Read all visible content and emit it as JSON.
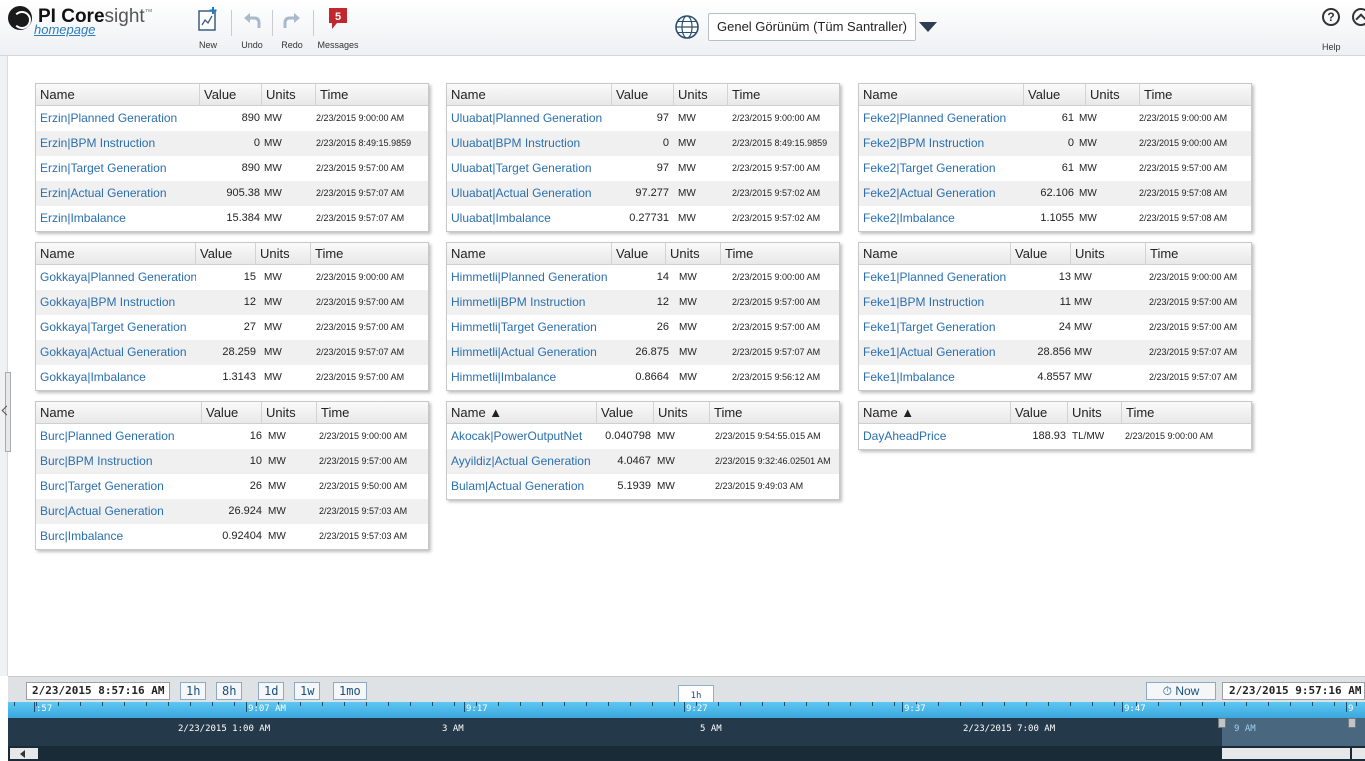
{
  "header": {
    "logo_bold": "PI Core",
    "logo_light": "sight",
    "logo_tm": "™",
    "homepage_link": "homepage",
    "toolbar": {
      "new_label": "New",
      "undo_label": "Undo",
      "redo_label": "Redo",
      "messages_label": "Messages",
      "messages_count": "5"
    },
    "display_name": "Genel Görünüm (Tüm Santraller)",
    "help_label": "Help",
    "help_glyph": "?"
  },
  "columns": {
    "name": "Name",
    "name_sorted": "Name ▲",
    "value": "Value",
    "units": "Units",
    "time": "Time"
  },
  "tables": [
    {
      "sorted": false,
      "rows": [
        {
          "name": "Erzin|Planned Generation",
          "value": "890",
          "units": "MW",
          "time": "2/23/2015 9:00:00 AM"
        },
        {
          "name": "Erzin|BPM Instruction",
          "value": "0",
          "units": "MW",
          "time": "2/23/2015 8:49:15.9859"
        },
        {
          "name": "Erzin|Target Generation",
          "value": "890",
          "units": "MW",
          "time": "2/23/2015 9:57:00 AM"
        },
        {
          "name": "Erzin|Actual Generation",
          "value": "905.38",
          "units": "MW",
          "time": "2/23/2015 9:57:07 AM"
        },
        {
          "name": "Erzin|Imbalance",
          "value": "15.384",
          "units": "MW",
          "time": "2/23/2015 9:57:07 AM"
        }
      ]
    },
    {
      "sorted": false,
      "rows": [
        {
          "name": "Uluabat|Planned Generation",
          "value": "97",
          "units": "MW",
          "time": "2/23/2015 9:00:00 AM"
        },
        {
          "name": "Uluabat|BPM Instruction",
          "value": "0",
          "units": "MW",
          "time": "2/23/2015 8:49:15.9859"
        },
        {
          "name": "Uluabat|Target Generation",
          "value": "97",
          "units": "MW",
          "time": "2/23/2015 9:57:00 AM"
        },
        {
          "name": "Uluabat|Actual Generation",
          "value": "97.277",
          "units": "MW",
          "time": "2/23/2015 9:57:02 AM"
        },
        {
          "name": "Uluabat|Imbalance",
          "value": "0.27731",
          "units": "MW",
          "time": "2/23/2015 9:57:02 AM"
        }
      ]
    },
    {
      "sorted": false,
      "rows": [
        {
          "name": "Feke2|Planned Generation",
          "value": "61",
          "units": "MW",
          "time": "2/23/2015 9:00:00 AM"
        },
        {
          "name": "Feke2|BPM Instruction",
          "value": "0",
          "units": "MW",
          "time": "2/23/2015 9:00:00 AM"
        },
        {
          "name": "Feke2|Target Generation",
          "value": "61",
          "units": "MW",
          "time": "2/23/2015 9:57:00 AM"
        },
        {
          "name": "Feke2|Actual Generation",
          "value": "62.106",
          "units": "MW",
          "time": "2/23/2015 9:57:08 AM"
        },
        {
          "name": "Feke2|Imbalance",
          "value": "1.1055",
          "units": "MW",
          "time": "2/23/2015 9:57:08 AM"
        }
      ]
    },
    {
      "sorted": false,
      "rows": [
        {
          "name": "Gokkaya|Planned Generation",
          "value": "15",
          "units": "MW",
          "time": "2/23/2015 9:00:00 AM"
        },
        {
          "name": "Gokkaya|BPM Instruction",
          "value": "12",
          "units": "MW",
          "time": "2/23/2015 9:57:00 AM"
        },
        {
          "name": "Gokkaya|Target Generation",
          "value": "27",
          "units": "MW",
          "time": "2/23/2015 9:57:00 AM"
        },
        {
          "name": "Gokkaya|Actual Generation",
          "value": "28.259",
          "units": "MW",
          "time": "2/23/2015 9:57:07 AM"
        },
        {
          "name": "Gokkaya|Imbalance",
          "value": "1.3143",
          "units": "MW",
          "time": "2/23/2015 9:57:00 AM"
        }
      ]
    },
    {
      "sorted": false,
      "rows": [
        {
          "name": "Himmetli|Planned Generation",
          "value": "14",
          "units": "MW",
          "time": "2/23/2015 9:00:00 AM"
        },
        {
          "name": "Himmetli|BPM Instruction",
          "value": "12",
          "units": "MW",
          "time": "2/23/2015 9:57:00 AM"
        },
        {
          "name": "Himmetli|Target Generation",
          "value": "26",
          "units": "MW",
          "time": "2/23/2015 9:57:00 AM"
        },
        {
          "name": "Himmetli|Actual Generation",
          "value": "26.875",
          "units": "MW",
          "time": "2/23/2015 9:57:07 AM"
        },
        {
          "name": "Himmetli|Imbalance",
          "value": "0.8664",
          "units": "MW",
          "time": "2/23/2015 9:56:12 AM"
        }
      ]
    },
    {
      "sorted": false,
      "rows": [
        {
          "name": "Feke1|Planned Generation",
          "value": "13",
          "units": "MW",
          "time": "2/23/2015 9:00:00 AM"
        },
        {
          "name": "Feke1|BPM Instruction",
          "value": "11",
          "units": "MW",
          "time": "2/23/2015 9:57:00 AM"
        },
        {
          "name": "Feke1|Target Generation",
          "value": "24",
          "units": "MW",
          "time": "2/23/2015 9:57:00 AM"
        },
        {
          "name": "Feke1|Actual Generation",
          "value": "28.856",
          "units": "MW",
          "time": "2/23/2015 9:57:07 AM"
        },
        {
          "name": "Feke1|Imbalance",
          "value": "4.8557",
          "units": "MW",
          "time": "2/23/2015 9:57:07 AM"
        }
      ]
    },
    {
      "sorted": false,
      "rows": [
        {
          "name": "Burc|Planned Generation",
          "value": "16",
          "units": "MW",
          "time": "2/23/2015 9:00:00 AM"
        },
        {
          "name": "Burc|BPM Instruction",
          "value": "10",
          "units": "MW",
          "time": "2/23/2015 9:57:00 AM"
        },
        {
          "name": "Burc|Target Generation",
          "value": "26",
          "units": "MW",
          "time": "2/23/2015 9:50:00 AM"
        },
        {
          "name": "Burc|Actual Generation",
          "value": "26.924",
          "units": "MW",
          "time": "2/23/2015 9:57:03 AM"
        },
        {
          "name": "Burc|Imbalance",
          "value": "0.92404",
          "units": "MW",
          "time": "2/23/2015 9:57:03 AM"
        }
      ]
    },
    {
      "sorted": true,
      "rows": [
        {
          "name": "Akocak|PowerOutputNet",
          "value": "0.040798",
          "units": "MW",
          "time": "2/23/2015 9:54:55.015 AM"
        },
        {
          "name": "Ayyildiz|Actual Generation",
          "value": "4.0467",
          "units": "MW",
          "time": "2/23/2015 9:32:46.02501 AM"
        },
        {
          "name": "Bulam|Actual Generation",
          "value": "5.1939",
          "units": "MW",
          "time": "2/23/2015 9:49:03 AM"
        }
      ]
    },
    {
      "sorted": true,
      "rows": [
        {
          "name": "DayAheadPrice",
          "value": "188.93",
          "units": "TL/MW",
          "time": "2/23/2015 9:00:00 AM"
        }
      ]
    }
  ],
  "timebar": {
    "start_time": "2/23/2015 8:57:16 AM",
    "end_time": "2/23/2015 9:57:16 AM",
    "range_buttons": [
      "1h",
      "8h",
      "1d",
      "1w",
      "1mo"
    ],
    "duration_tab": "1h",
    "now_label": "Now",
    "scale_labels": [
      ":57",
      "9:07 AM",
      "9:17",
      "9:27",
      "9:37",
      "9:47",
      "9"
    ],
    "overview_labels": [
      "2/23/2015 1:00 AM",
      "3 AM",
      "5 AM",
      "2/23/2015 7:00 AM"
    ],
    "overview_selection_label": "9 AM"
  }
}
